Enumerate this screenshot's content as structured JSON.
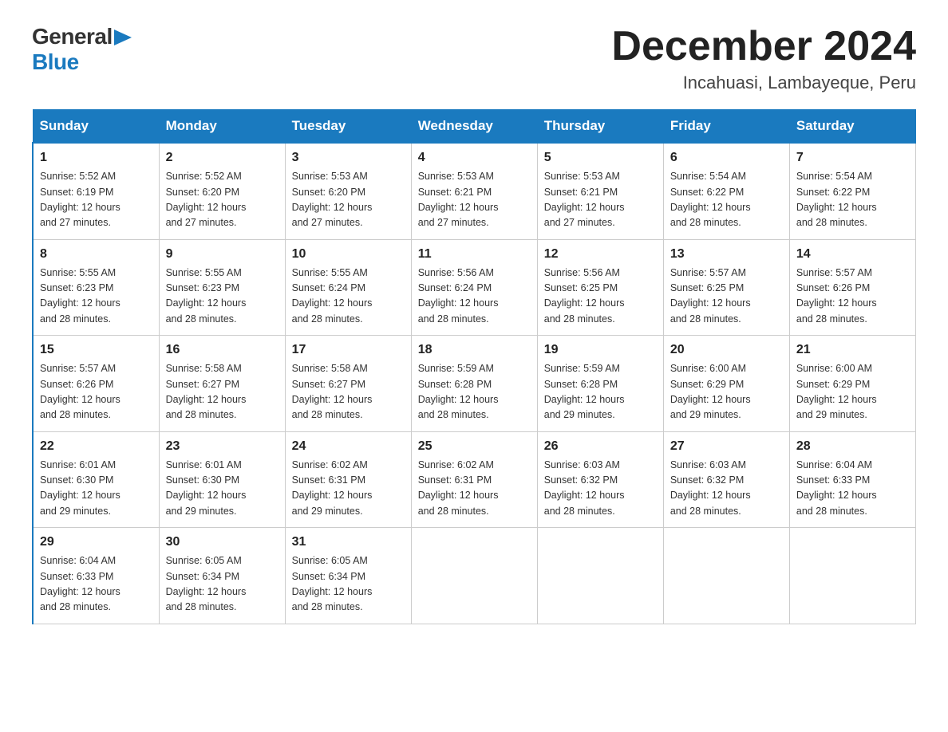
{
  "logo": {
    "general": "General",
    "blue": "Blue"
  },
  "title": "December 2024",
  "location": "Incahuasi, Lambayeque, Peru",
  "days_of_week": [
    "Sunday",
    "Monday",
    "Tuesday",
    "Wednesday",
    "Thursday",
    "Friday",
    "Saturday"
  ],
  "weeks": [
    [
      {
        "day": "1",
        "sunrise": "5:52 AM",
        "sunset": "6:19 PM",
        "daylight": "12 hours and 27 minutes."
      },
      {
        "day": "2",
        "sunrise": "5:52 AM",
        "sunset": "6:20 PM",
        "daylight": "12 hours and 27 minutes."
      },
      {
        "day": "3",
        "sunrise": "5:53 AM",
        "sunset": "6:20 PM",
        "daylight": "12 hours and 27 minutes."
      },
      {
        "day": "4",
        "sunrise": "5:53 AM",
        "sunset": "6:21 PM",
        "daylight": "12 hours and 27 minutes."
      },
      {
        "day": "5",
        "sunrise": "5:53 AM",
        "sunset": "6:21 PM",
        "daylight": "12 hours and 27 minutes."
      },
      {
        "day": "6",
        "sunrise": "5:54 AM",
        "sunset": "6:22 PM",
        "daylight": "12 hours and 28 minutes."
      },
      {
        "day": "7",
        "sunrise": "5:54 AM",
        "sunset": "6:22 PM",
        "daylight": "12 hours and 28 minutes."
      }
    ],
    [
      {
        "day": "8",
        "sunrise": "5:55 AM",
        "sunset": "6:23 PM",
        "daylight": "12 hours and 28 minutes."
      },
      {
        "day": "9",
        "sunrise": "5:55 AM",
        "sunset": "6:23 PM",
        "daylight": "12 hours and 28 minutes."
      },
      {
        "day": "10",
        "sunrise": "5:55 AM",
        "sunset": "6:24 PM",
        "daylight": "12 hours and 28 minutes."
      },
      {
        "day": "11",
        "sunrise": "5:56 AM",
        "sunset": "6:24 PM",
        "daylight": "12 hours and 28 minutes."
      },
      {
        "day": "12",
        "sunrise": "5:56 AM",
        "sunset": "6:25 PM",
        "daylight": "12 hours and 28 minutes."
      },
      {
        "day": "13",
        "sunrise": "5:57 AM",
        "sunset": "6:25 PM",
        "daylight": "12 hours and 28 minutes."
      },
      {
        "day": "14",
        "sunrise": "5:57 AM",
        "sunset": "6:26 PM",
        "daylight": "12 hours and 28 minutes."
      }
    ],
    [
      {
        "day": "15",
        "sunrise": "5:57 AM",
        "sunset": "6:26 PM",
        "daylight": "12 hours and 28 minutes."
      },
      {
        "day": "16",
        "sunrise": "5:58 AM",
        "sunset": "6:27 PM",
        "daylight": "12 hours and 28 minutes."
      },
      {
        "day": "17",
        "sunrise": "5:58 AM",
        "sunset": "6:27 PM",
        "daylight": "12 hours and 28 minutes."
      },
      {
        "day": "18",
        "sunrise": "5:59 AM",
        "sunset": "6:28 PM",
        "daylight": "12 hours and 28 minutes."
      },
      {
        "day": "19",
        "sunrise": "5:59 AM",
        "sunset": "6:28 PM",
        "daylight": "12 hours and 29 minutes."
      },
      {
        "day": "20",
        "sunrise": "6:00 AM",
        "sunset": "6:29 PM",
        "daylight": "12 hours and 29 minutes."
      },
      {
        "day": "21",
        "sunrise": "6:00 AM",
        "sunset": "6:29 PM",
        "daylight": "12 hours and 29 minutes."
      }
    ],
    [
      {
        "day": "22",
        "sunrise": "6:01 AM",
        "sunset": "6:30 PM",
        "daylight": "12 hours and 29 minutes."
      },
      {
        "day": "23",
        "sunrise": "6:01 AM",
        "sunset": "6:30 PM",
        "daylight": "12 hours and 29 minutes."
      },
      {
        "day": "24",
        "sunrise": "6:02 AM",
        "sunset": "6:31 PM",
        "daylight": "12 hours and 29 minutes."
      },
      {
        "day": "25",
        "sunrise": "6:02 AM",
        "sunset": "6:31 PM",
        "daylight": "12 hours and 28 minutes."
      },
      {
        "day": "26",
        "sunrise": "6:03 AM",
        "sunset": "6:32 PM",
        "daylight": "12 hours and 28 minutes."
      },
      {
        "day": "27",
        "sunrise": "6:03 AM",
        "sunset": "6:32 PM",
        "daylight": "12 hours and 28 minutes."
      },
      {
        "day": "28",
        "sunrise": "6:04 AM",
        "sunset": "6:33 PM",
        "daylight": "12 hours and 28 minutes."
      }
    ],
    [
      {
        "day": "29",
        "sunrise": "6:04 AM",
        "sunset": "6:33 PM",
        "daylight": "12 hours and 28 minutes."
      },
      {
        "day": "30",
        "sunrise": "6:05 AM",
        "sunset": "6:34 PM",
        "daylight": "12 hours and 28 minutes."
      },
      {
        "day": "31",
        "sunrise": "6:05 AM",
        "sunset": "6:34 PM",
        "daylight": "12 hours and 28 minutes."
      },
      null,
      null,
      null,
      null
    ]
  ]
}
